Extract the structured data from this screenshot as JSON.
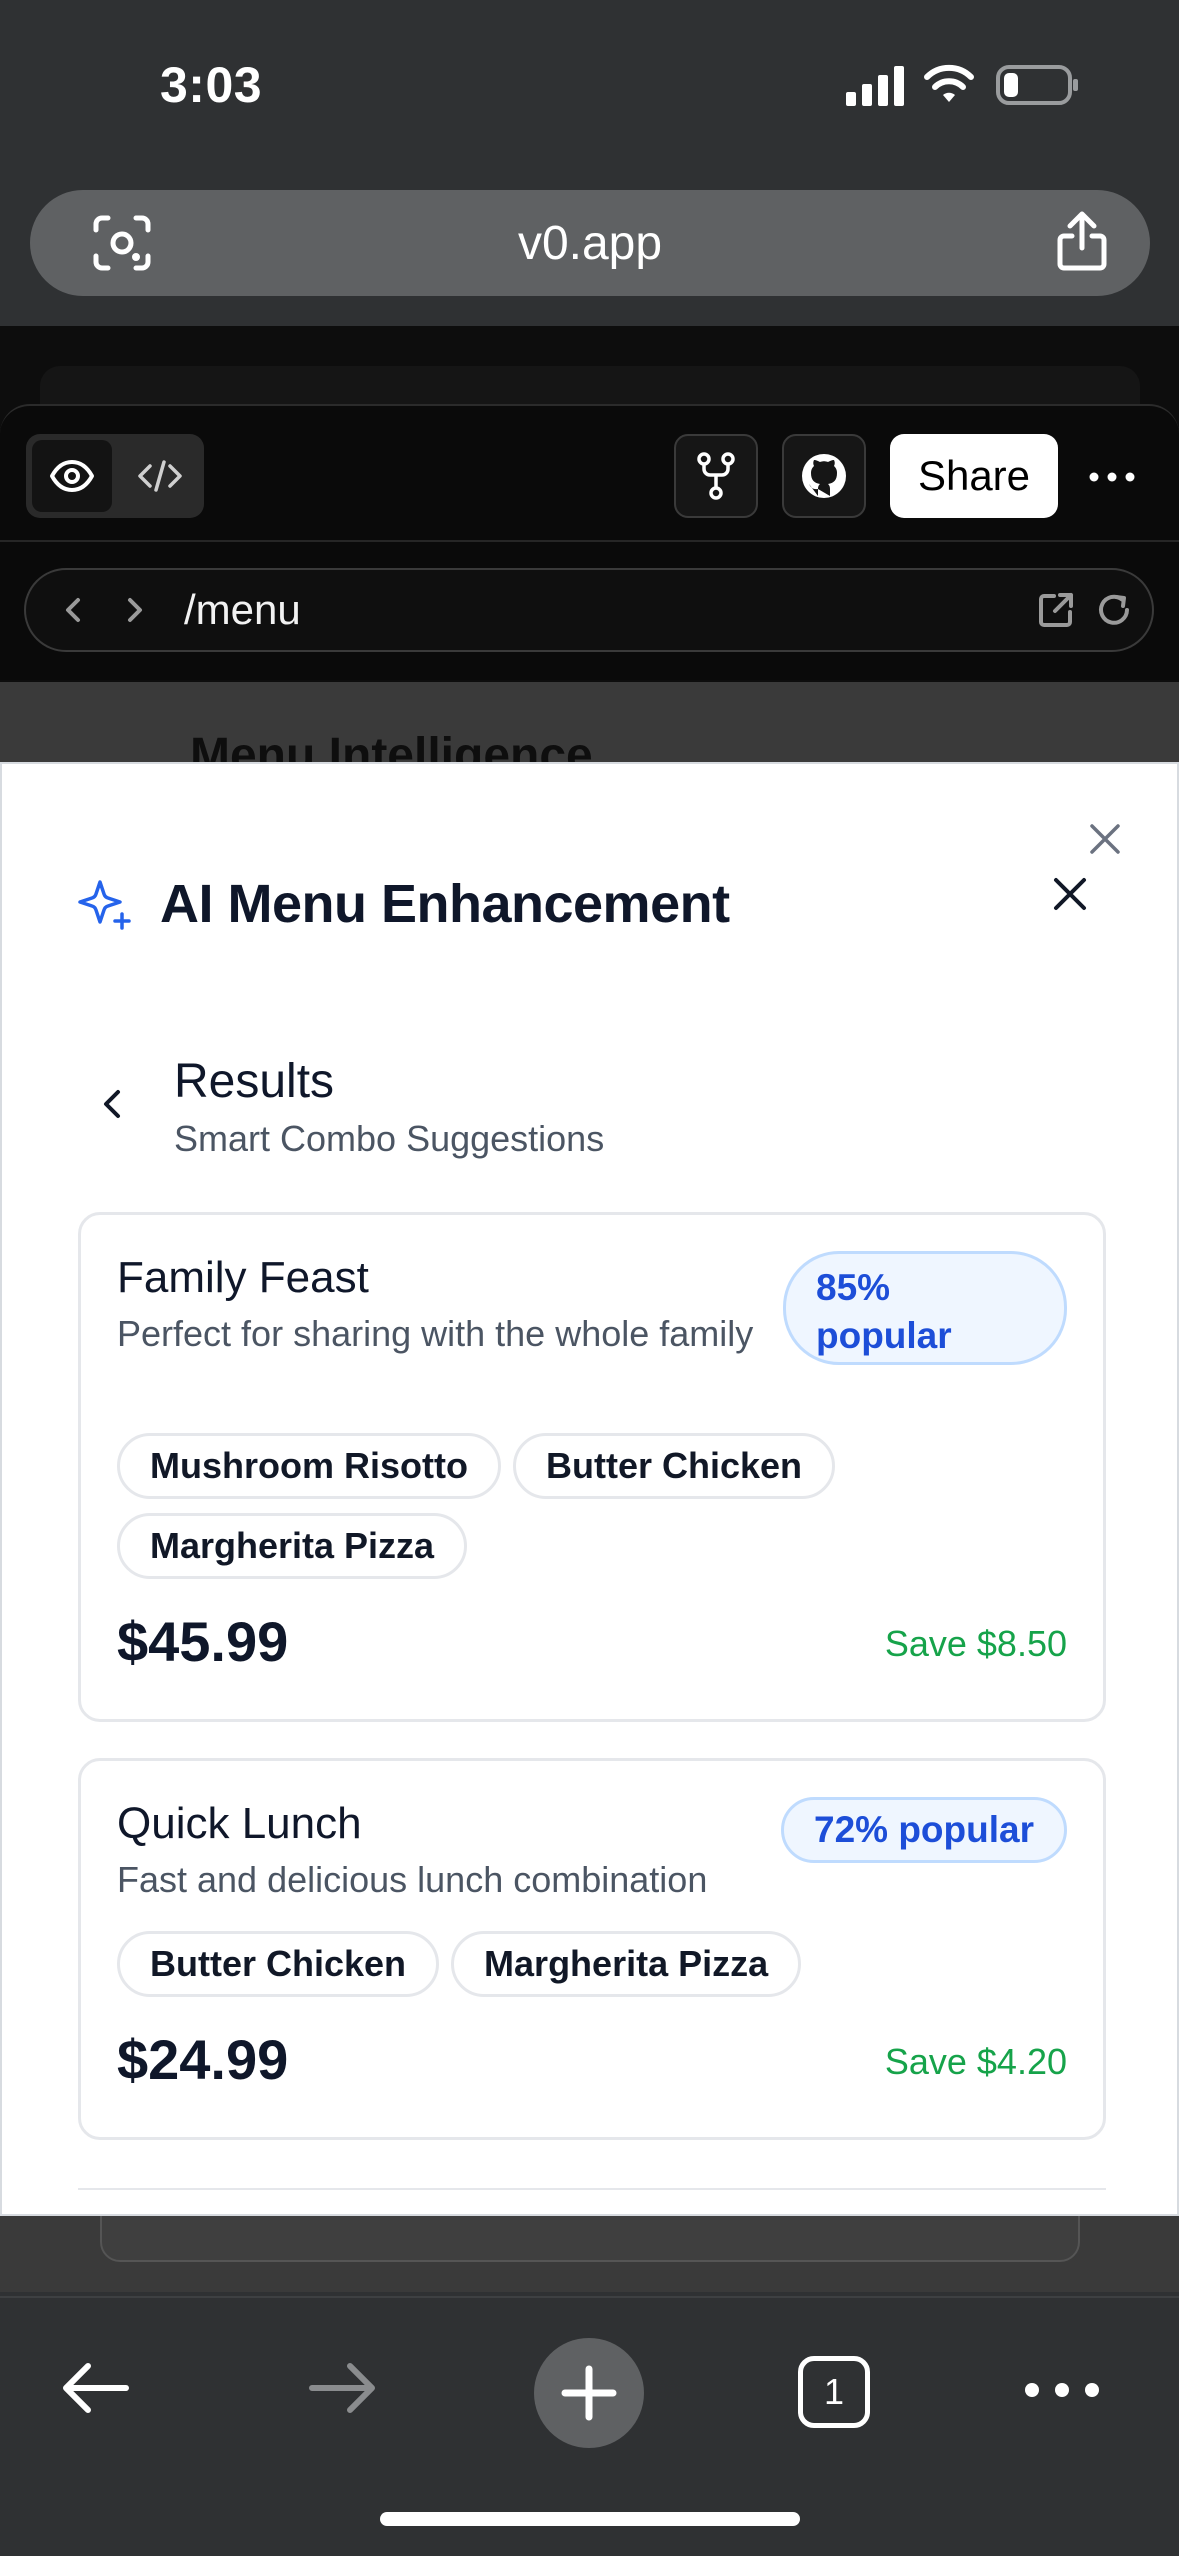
{
  "status_bar": {
    "time": "3:03"
  },
  "browser": {
    "url": "v0.app"
  },
  "toolbar": {
    "share_label": "Share"
  },
  "route": {
    "path": "/menu"
  },
  "background_app": {
    "title": "Menu Intelligence"
  },
  "modal": {
    "title": "AI Menu Enhancement",
    "section_title": "Results",
    "section_subtitle": "Smart Combo Suggestions",
    "combos": [
      {
        "name": "Family Feast",
        "description": "Perfect for sharing with the whole family",
        "popularity": "85% popular",
        "items": [
          "Mushroom Risotto",
          "Butter Chicken",
          "Margherita Pizza"
        ],
        "price": "$45.99",
        "savings": "Save $8.50"
      },
      {
        "name": "Quick Lunch",
        "description": "Fast and delicious lunch combination",
        "popularity": "72% popular",
        "items": [
          "Butter Chicken",
          "Margherita Pizza"
        ],
        "price": "$24.99",
        "savings": "Save $4.20"
      }
    ]
  },
  "bottom_bar": {
    "tab_count": "1"
  },
  "colors": {
    "accent_blue": "#1d4ed8",
    "savings_green": "#16a34a",
    "chrome_bg": "#2f3133"
  }
}
